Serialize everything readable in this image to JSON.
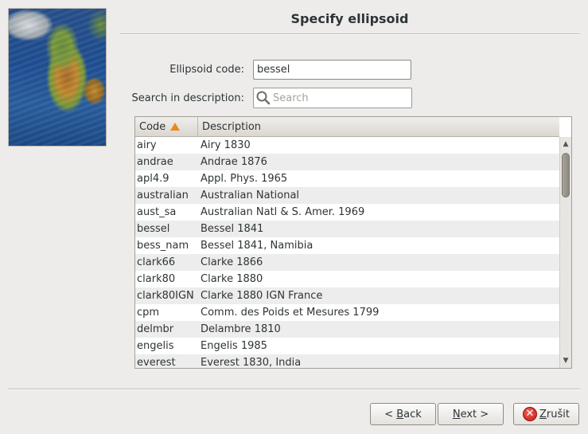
{
  "header": {
    "title": "Specify ellipsoid"
  },
  "form": {
    "code_label": "Ellipsoid code:",
    "code_value": "bessel",
    "search_label": "Search in description:",
    "search_placeholder": "Search"
  },
  "table": {
    "columns": [
      "Code",
      "Description"
    ],
    "sort_icon": "sort-ascending-icon",
    "rows": [
      {
        "code": "airy",
        "desc": "Airy 1830"
      },
      {
        "code": "andrae",
        "desc": "Andrae 1876"
      },
      {
        "code": "apl4.9",
        "desc": "Appl. Phys. 1965"
      },
      {
        "code": "australian",
        "desc": "Australian National"
      },
      {
        "code": "aust_sa",
        "desc": "Australian Natl & S. Amer. 1969"
      },
      {
        "code": "bessel",
        "desc": "Bessel 1841"
      },
      {
        "code": "bess_nam",
        "desc": "Bessel 1841, Namibia"
      },
      {
        "code": "clark66",
        "desc": "Clarke 1866"
      },
      {
        "code": "clark80",
        "desc": "Clarke 1880"
      },
      {
        "code": "clark80IGN",
        "desc": "Clarke 1880 IGN France"
      },
      {
        "code": "cpm",
        "desc": "Comm. des Poids et Mesures 1799"
      },
      {
        "code": "delmbr",
        "desc": "Delambre 1810"
      },
      {
        "code": "engelis",
        "desc": "Engelis 1985"
      },
      {
        "code": "everest",
        "desc": "Everest 1830, India"
      }
    ]
  },
  "buttons": {
    "back_prefix": "< ",
    "back_mnemonic": "B",
    "back_rest": "ack",
    "next_mnemonic": "N",
    "next_rest": "ext >",
    "cancel_mnemonic": "Z",
    "cancel_rest": "rušit"
  }
}
